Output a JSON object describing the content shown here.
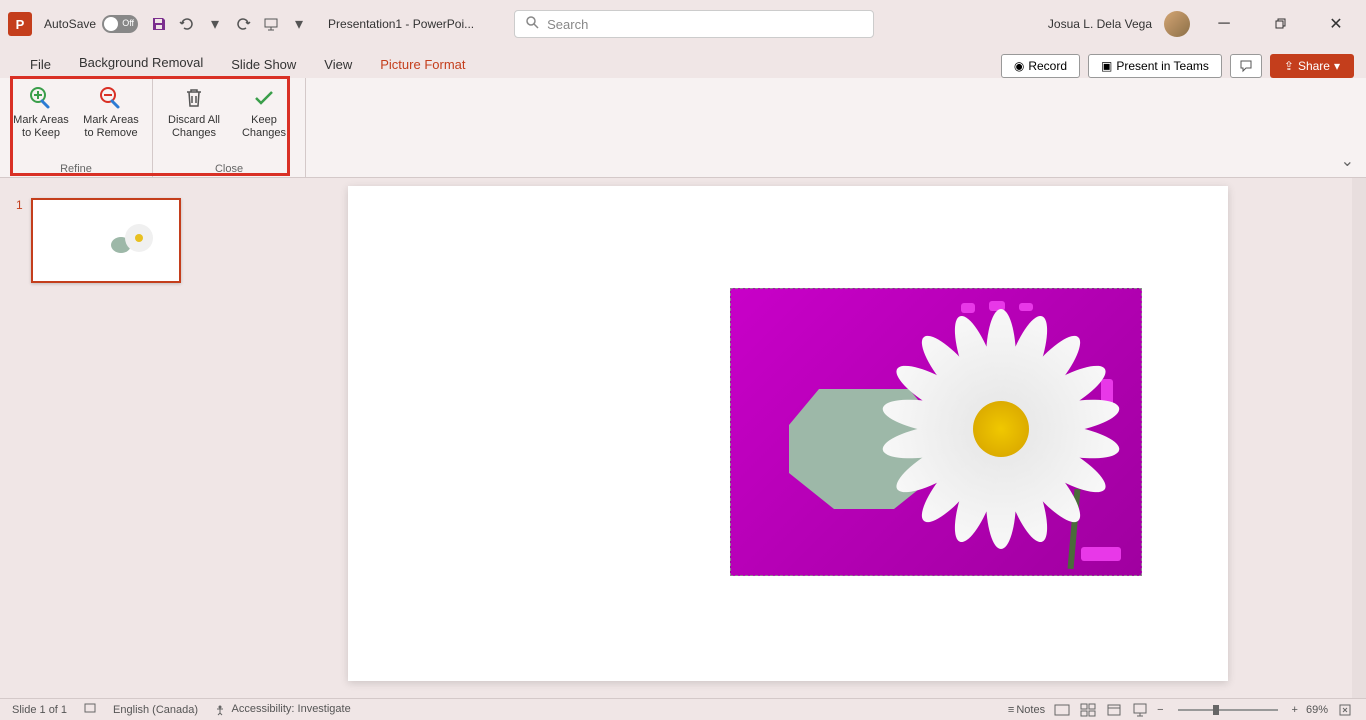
{
  "titlebar": {
    "autosave_label": "AutoSave",
    "autosave_state": "Off",
    "doc_title": "Presentation1 - PowerPoi...",
    "search_placeholder": "Search",
    "user_name": "Josua L. Dela Vega"
  },
  "tabs": {
    "file": "File",
    "bg_removal": "Background Removal",
    "slideshow": "Slide Show",
    "view": "View",
    "picture_format": "Picture Format"
  },
  "ribbon_right": {
    "record": "Record",
    "present": "Present in Teams",
    "share": "Share"
  },
  "ribbon": {
    "refine": {
      "mark_keep": "Mark Areas to Keep",
      "mark_remove": "Mark Areas to Remove",
      "group_label": "Refine"
    },
    "close": {
      "discard": "Discard All Changes",
      "keep": "Keep Changes",
      "group_label": "Close"
    }
  },
  "thumbnail": {
    "number": "1"
  },
  "statusbar": {
    "slide_info": "Slide 1 of 1",
    "language": "English (Canada)",
    "accessibility": "Accessibility: Investigate",
    "notes": "Notes",
    "zoom_pct": "69%"
  }
}
